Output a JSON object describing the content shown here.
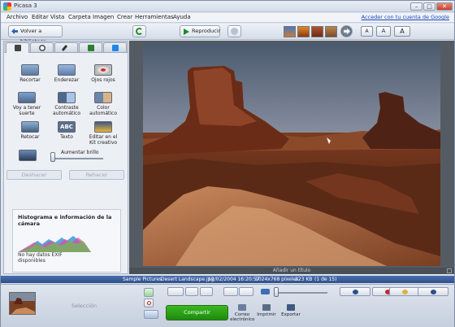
{
  "window": {
    "title": "Picasa 3",
    "controls": {
      "minimize": "–",
      "maximize": "□",
      "close": "✕"
    }
  },
  "menu": {
    "items": [
      "Archivo",
      "Editar",
      "Vista",
      "Carpeta",
      "Imagen",
      "Crear",
      "Herramientas",
      "Ayuda"
    ],
    "google_link": "Acceder con tu cuenta de Google"
  },
  "toolbar": {
    "back_label": "Volver a biblioteca",
    "play_label": "Reproducir",
    "caption_sizes": [
      "A",
      "A",
      "A"
    ]
  },
  "panel": {
    "tabs": [
      "wrench-icon",
      "contrast-icon",
      "brush-icon",
      "pen-icon",
      "pen-blue-icon"
    ],
    "tools": [
      {
        "name": "recortar",
        "label": "Recortar"
      },
      {
        "name": "enderezar",
        "label": "Enderezar"
      },
      {
        "name": "ojos-rojos",
        "label": "Ojos rojos"
      },
      {
        "name": "voy-a-tener-suerte",
        "label": "Voy a tener suerte"
      },
      {
        "name": "contraste-automatico",
        "label": "Contraste automático"
      },
      {
        "name": "color-automatico",
        "label": "Color automático"
      },
      {
        "name": "retocar",
        "label": "Retocar"
      },
      {
        "name": "texto",
        "label": "Texto"
      },
      {
        "name": "editar-kit",
        "label": "Editar en el Kit creativo"
      }
    ],
    "brightness_label": "Aumentar brillo",
    "brightness_level": 0,
    "undo_label": "Deshacer",
    "redo_label": "Rehacer",
    "histogram_title": "Histograma e información de la cámara",
    "exif_text": "No hay datos EXIF disponibles"
  },
  "viewer": {
    "caption_placeholder": "Añadir un título"
  },
  "infobar": {
    "path": "Sample Pictures",
    "filename": "Desert Landscape.jpg",
    "date": "12/02/2004 16:20:57",
    "dimensions": "1024x768 píxeles",
    "size": "223 KB",
    "position": "(1 de 15)"
  },
  "tray": {
    "selection_label": "Selección",
    "share_label": "Compartir",
    "actions": [
      {
        "name": "email",
        "label": "Correo electrónico"
      },
      {
        "name": "print",
        "label": "Imprimir"
      },
      {
        "name": "export",
        "label": "Exportar"
      }
    ]
  },
  "colors": {
    "accent": "#2f4f8a",
    "share": "#1d8a0e",
    "link": "#1b46b8"
  }
}
